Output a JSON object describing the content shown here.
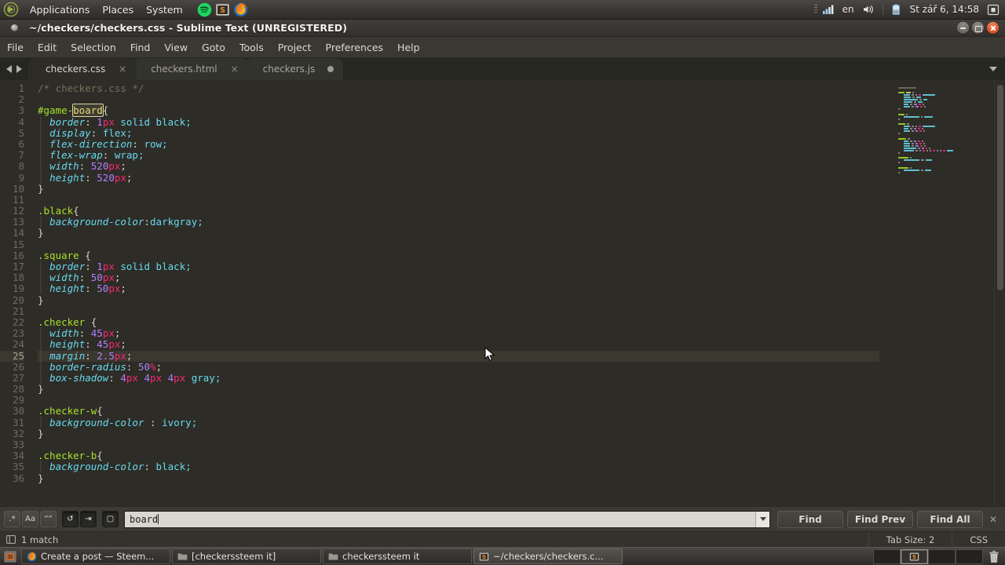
{
  "gnome_panel": {
    "logo": "ubuntu-logo",
    "menus": [
      "Applications",
      "Places",
      "System"
    ],
    "apps": [
      {
        "name": "spotify-icon",
        "label": "Spotify"
      },
      {
        "name": "sublime-text-icon",
        "label": "Sublime Text"
      },
      {
        "name": "firefox-icon",
        "label": "Firefox"
      }
    ],
    "tray": {
      "network_icon": "signal-bars-icon",
      "keyboard_layout": "en",
      "volume_icon": "volume-icon",
      "battery_icon": "battery-icon",
      "clock": "St zář 6, 14:58",
      "session_icon": "session-indicator-icon"
    }
  },
  "window": {
    "title": "~/checkers/checkers.css - Sublime Text (UNREGISTERED)",
    "buttons": {
      "minimize": "minimize",
      "maximize": "maximize",
      "close": "close"
    }
  },
  "menubar": {
    "items": [
      "File",
      "Edit",
      "Selection",
      "Find",
      "View",
      "Goto",
      "Tools",
      "Project",
      "Preferences",
      "Help"
    ]
  },
  "tabs": {
    "nav_prev_icon": "arrow-left-icon",
    "nav_next_icon": "arrow-right-icon",
    "overflow_icon": "chevron-down-icon",
    "items": [
      {
        "label": "checkers.css",
        "active": true,
        "dirty": false,
        "close_glyph": "×"
      },
      {
        "label": "checkers.html",
        "active": false,
        "dirty": false,
        "close_glyph": "×"
      },
      {
        "label": "checkers.js",
        "active": false,
        "dirty": true,
        "close_glyph": "×"
      }
    ]
  },
  "editor": {
    "language": "CSS",
    "cursor_line": 25,
    "first_line": 1,
    "last_line": 36,
    "lines": [
      {
        "n": 1,
        "tokens": [
          {
            "t": "/* checkers.css */",
            "c": "c-comment"
          }
        ]
      },
      {
        "n": 2,
        "tokens": []
      },
      {
        "n": 3,
        "tokens": [
          {
            "t": "#game-",
            "c": "c-id"
          },
          {
            "t": "board",
            "c": "hl-match"
          },
          {
            "t": "{",
            "c": "c-brace"
          }
        ]
      },
      {
        "n": 4,
        "indent": 1,
        "tokens": [
          {
            "t": "border",
            "c": "c-prop"
          },
          {
            "t": ": ",
            "c": "c-punct"
          },
          {
            "t": "1",
            "c": "c-num"
          },
          {
            "t": "px",
            "c": "c-unit"
          },
          {
            "t": " solid black;",
            "c": "c-val"
          }
        ]
      },
      {
        "n": 5,
        "indent": 1,
        "tokens": [
          {
            "t": "display",
            "c": "c-prop"
          },
          {
            "t": ": ",
            "c": "c-punct"
          },
          {
            "t": "flex;",
            "c": "c-val"
          }
        ]
      },
      {
        "n": 6,
        "indent": 1,
        "tokens": [
          {
            "t": "flex-direction",
            "c": "c-prop"
          },
          {
            "t": ": ",
            "c": "c-punct"
          },
          {
            "t": "row;",
            "c": "c-val"
          }
        ]
      },
      {
        "n": 7,
        "indent": 1,
        "tokens": [
          {
            "t": "flex-wrap",
            "c": "c-prop"
          },
          {
            "t": ": ",
            "c": "c-punct"
          },
          {
            "t": "wrap;",
            "c": "c-val"
          }
        ]
      },
      {
        "n": 8,
        "indent": 1,
        "tokens": [
          {
            "t": "width",
            "c": "c-prop"
          },
          {
            "t": ": ",
            "c": "c-punct"
          },
          {
            "t": "520",
            "c": "c-num"
          },
          {
            "t": "px",
            "c": "c-unit"
          },
          {
            "t": ";",
            "c": "c-punct"
          }
        ]
      },
      {
        "n": 9,
        "indent": 1,
        "tokens": [
          {
            "t": "height",
            "c": "c-prop"
          },
          {
            "t": ": ",
            "c": "c-punct"
          },
          {
            "t": "520",
            "c": "c-num"
          },
          {
            "t": "px",
            "c": "c-unit"
          },
          {
            "t": ";",
            "c": "c-punct"
          }
        ]
      },
      {
        "n": 10,
        "tokens": [
          {
            "t": "}",
            "c": "c-brace"
          }
        ]
      },
      {
        "n": 11,
        "tokens": []
      },
      {
        "n": 12,
        "tokens": [
          {
            "t": ".black",
            "c": "c-sel"
          },
          {
            "t": "{",
            "c": "c-brace"
          }
        ]
      },
      {
        "n": 13,
        "indent": 1,
        "tokens": [
          {
            "t": "background-color",
            "c": "c-prop"
          },
          {
            "t": ":",
            "c": "c-punct"
          },
          {
            "t": "darkgray;",
            "c": "c-val"
          }
        ]
      },
      {
        "n": 14,
        "tokens": [
          {
            "t": "}",
            "c": "c-brace"
          }
        ]
      },
      {
        "n": 15,
        "tokens": []
      },
      {
        "n": 16,
        "tokens": [
          {
            "t": ".square",
            "c": "c-sel"
          },
          {
            "t": " {",
            "c": "c-brace"
          }
        ]
      },
      {
        "n": 17,
        "indent": 1,
        "tokens": [
          {
            "t": "border",
            "c": "c-prop"
          },
          {
            "t": ": ",
            "c": "c-punct"
          },
          {
            "t": "1",
            "c": "c-num"
          },
          {
            "t": "px",
            "c": "c-unit"
          },
          {
            "t": " solid black;",
            "c": "c-val"
          }
        ]
      },
      {
        "n": 18,
        "indent": 1,
        "tokens": [
          {
            "t": "width",
            "c": "c-prop"
          },
          {
            "t": ": ",
            "c": "c-punct"
          },
          {
            "t": "50",
            "c": "c-num"
          },
          {
            "t": "px",
            "c": "c-unit"
          },
          {
            "t": ";",
            "c": "c-punct"
          }
        ]
      },
      {
        "n": 19,
        "indent": 1,
        "tokens": [
          {
            "t": "height",
            "c": "c-prop"
          },
          {
            "t": ": ",
            "c": "c-punct"
          },
          {
            "t": "50",
            "c": "c-num"
          },
          {
            "t": "px",
            "c": "c-unit"
          },
          {
            "t": ";",
            "c": "c-punct"
          }
        ]
      },
      {
        "n": 20,
        "tokens": [
          {
            "t": "}",
            "c": "c-brace"
          }
        ]
      },
      {
        "n": 21,
        "tokens": []
      },
      {
        "n": 22,
        "tokens": [
          {
            "t": ".checker",
            "c": "c-sel"
          },
          {
            "t": " {",
            "c": "c-brace"
          }
        ]
      },
      {
        "n": 23,
        "indent": 1,
        "tokens": [
          {
            "t": "width",
            "c": "c-prop"
          },
          {
            "t": ": ",
            "c": "c-punct"
          },
          {
            "t": "45",
            "c": "c-num"
          },
          {
            "t": "px",
            "c": "c-unit"
          },
          {
            "t": ";",
            "c": "c-punct"
          }
        ]
      },
      {
        "n": 24,
        "indent": 1,
        "tokens": [
          {
            "t": "height",
            "c": "c-prop"
          },
          {
            "t": ": ",
            "c": "c-punct"
          },
          {
            "t": "45",
            "c": "c-num"
          },
          {
            "t": "px",
            "c": "c-unit"
          },
          {
            "t": ";",
            "c": "c-punct"
          }
        ]
      },
      {
        "n": 25,
        "indent": 1,
        "cursor": true,
        "tokens": [
          {
            "t": "margin",
            "c": "c-prop"
          },
          {
            "t": ": ",
            "c": "c-punct"
          },
          {
            "t": "2.5",
            "c": "c-num"
          },
          {
            "t": "px",
            "c": "c-unit"
          },
          {
            "t": ";",
            "c": "c-punct"
          }
        ]
      },
      {
        "n": 26,
        "indent": 1,
        "tokens": [
          {
            "t": "border-radius",
            "c": "c-prop"
          },
          {
            "t": ": ",
            "c": "c-punct"
          },
          {
            "t": "50",
            "c": "c-num"
          },
          {
            "t": "%",
            "c": "c-unit"
          },
          {
            "t": ";",
            "c": "c-punct"
          }
        ]
      },
      {
        "n": 27,
        "indent": 1,
        "tokens": [
          {
            "t": "box-shadow",
            "c": "c-prop"
          },
          {
            "t": ": ",
            "c": "c-punct"
          },
          {
            "t": "4",
            "c": "c-num"
          },
          {
            "t": "px",
            "c": "c-unit"
          },
          {
            "t": " ",
            "c": "c-punct"
          },
          {
            "t": "4",
            "c": "c-num"
          },
          {
            "t": "px",
            "c": "c-unit"
          },
          {
            "t": " ",
            "c": "c-punct"
          },
          {
            "t": "4",
            "c": "c-num"
          },
          {
            "t": "px",
            "c": "c-unit"
          },
          {
            "t": " gray;",
            "c": "c-val"
          }
        ]
      },
      {
        "n": 28,
        "tokens": [
          {
            "t": "}",
            "c": "c-brace"
          }
        ]
      },
      {
        "n": 29,
        "tokens": []
      },
      {
        "n": 30,
        "tokens": [
          {
            "t": ".checker-w",
            "c": "c-sel"
          },
          {
            "t": "{",
            "c": "c-brace"
          }
        ]
      },
      {
        "n": 31,
        "indent": 1,
        "tokens": [
          {
            "t": "background-color",
            "c": "c-prop"
          },
          {
            "t": " : ",
            "c": "c-punct"
          },
          {
            "t": "ivory;",
            "c": "c-val"
          }
        ]
      },
      {
        "n": 32,
        "tokens": [
          {
            "t": "}",
            "c": "c-brace"
          }
        ]
      },
      {
        "n": 33,
        "tokens": []
      },
      {
        "n": 34,
        "tokens": [
          {
            "t": ".checker-b",
            "c": "c-sel"
          },
          {
            "t": "{",
            "c": "c-brace"
          }
        ]
      },
      {
        "n": 35,
        "indent": 1,
        "tokens": [
          {
            "t": "background-color",
            "c": "c-prop"
          },
          {
            "t": ": ",
            "c": "c-punct"
          },
          {
            "t": "black;",
            "c": "c-val"
          }
        ]
      },
      {
        "n": 36,
        "tokens": [
          {
            "t": "}",
            "c": "c-brace"
          }
        ]
      }
    ]
  },
  "findbar": {
    "toggles": [
      {
        "name": "regex-toggle",
        "glyph": ".*",
        "active": false
      },
      {
        "name": "case-sensitive-toggle",
        "glyph": "Aa",
        "active": false
      },
      {
        "name": "whole-word-toggle",
        "glyph": "“”",
        "active": false
      },
      {
        "name": "wrap-toggle",
        "glyph": "↺",
        "active": true
      },
      {
        "name": "in-selection-toggle",
        "glyph": "⇥",
        "active": true
      },
      {
        "name": "highlight-results-toggle",
        "glyph": "▢",
        "active": true
      }
    ],
    "query": "board",
    "placeholder": "Find",
    "buttons": [
      "Find",
      "Find Prev",
      "Find All"
    ],
    "close_glyph": "✕"
  },
  "statusbar": {
    "left_icon": "sidebar-toggle-icon",
    "message": "1 match",
    "tab_size": "Tab Size: 2",
    "syntax": "CSS"
  },
  "taskbar": {
    "show_desktop_icon": "show-desktop-icon",
    "items": [
      {
        "label": "Create a post — Steem...",
        "icon": "firefox-icon",
        "active": false
      },
      {
        "label": "[checkerssteem it]",
        "icon": "folder-icon",
        "active": false
      },
      {
        "label": "checkerssteem it",
        "icon": "folder-icon",
        "active": false
      },
      {
        "label": "~/checkers/checkers.c...",
        "icon": "sublime-text-icon",
        "active": true
      }
    ],
    "workspaces": [
      {
        "index": 1,
        "active": false
      },
      {
        "index": 2,
        "active": true
      },
      {
        "index": 3,
        "active": false
      },
      {
        "index": 4,
        "active": false
      }
    ],
    "trash_icon": "trash-icon"
  },
  "colors": {
    "editor_bg": "#2e2c26",
    "accent_orange": "#e2592b",
    "selector_green": "#a6e22e",
    "property_cyan": "#66d9ef",
    "number_purple": "#ae81ff",
    "unit_pink": "#f92672",
    "comment_gray": "#75715e",
    "match_highlight": "#e6db74"
  }
}
